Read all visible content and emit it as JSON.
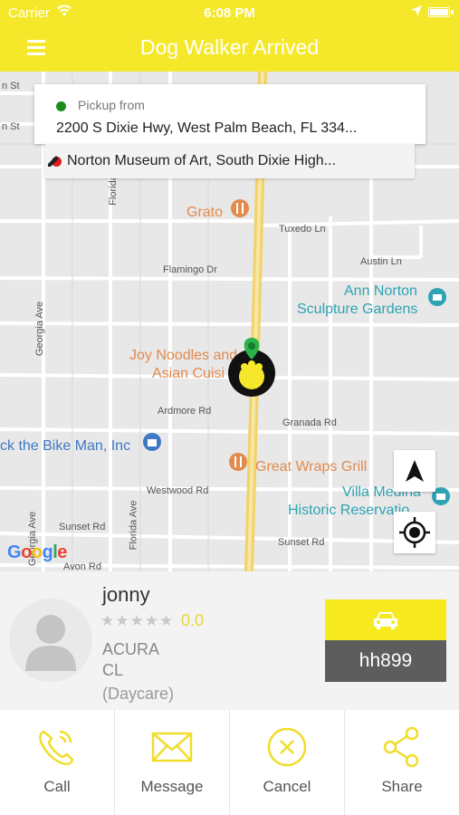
{
  "status_bar": {
    "carrier": "Carrier",
    "time": "6:08 PM"
  },
  "header": {
    "title": "Dog Walker Arrived",
    "menu_icon": "hamburger-icon"
  },
  "trip": {
    "pickup_label": "Pickup from",
    "pickup_address": "2200 S Dixie Hwy,  West Palm Beach,  FL 334...",
    "destination_address": "Norton Museum of Art, South Dixie High..."
  },
  "map": {
    "streets": [
      "n St",
      "n St",
      "Florida",
      "Tuxedo Ln",
      "Flamingo Dr",
      "Austin Ln",
      "Georgia Ave",
      "Ardmore Rd",
      "Granada Rd",
      "Westwood Rd",
      "Sunset Rd",
      "Sunset Rd",
      "Georgia Ave",
      "Florida Ave",
      "Avon Rd"
    ],
    "pois": {
      "grato": "Grato",
      "ann_norton": "Ann Norton",
      "sculpture_gardens": "Sculpture Gardens",
      "joy_noodles": "Joy Noodles and",
      "asian_cuisine": "Asian Cuisi",
      "bike_man": "ck the Bike Man, Inc",
      "great_wraps": "Great Wraps Grill",
      "villa_medina": "Villa Medina",
      "historic_reservation": "Historic Reservatio"
    },
    "google_logo": "Google",
    "colors": {
      "route": "#f2d26a",
      "poi_orange": "#e38a4d",
      "poi_teal": "#2ea3b3",
      "poi_blue": "#3f79c4"
    }
  },
  "driver": {
    "name": "jonny",
    "stars": "★★★★★",
    "rating": "0.0",
    "car_make": "ACURA",
    "car_model": "CL",
    "service": "(Daycare)",
    "plate": "hh899"
  },
  "actions": [
    {
      "label": "Call",
      "icon": "phone-icon"
    },
    {
      "label": "Message",
      "icon": "envelope-icon"
    },
    {
      "label": "Cancel",
      "icon": "cancel-icon"
    },
    {
      "label": "Share",
      "icon": "share-icon"
    }
  ],
  "theme": {
    "accent": "#f5e82a",
    "plate_bg": "#5d5d5d"
  }
}
